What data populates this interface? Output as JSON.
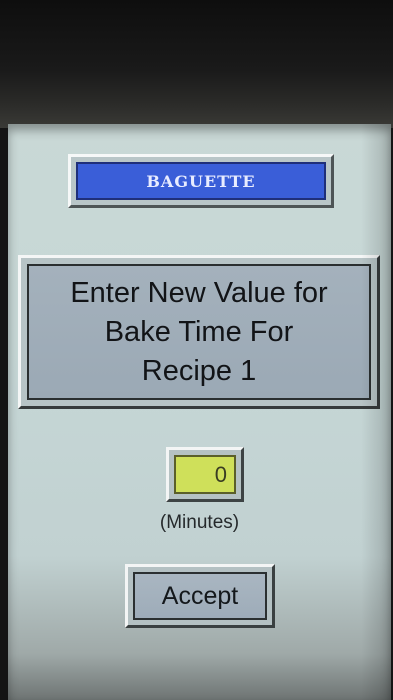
{
  "header": {
    "recipe_name": "BAGUETTE"
  },
  "prompt": {
    "line1": "Enter New Value for",
    "line2": "Bake Time For",
    "line3": "Recipe 1"
  },
  "value_field": {
    "value": "0",
    "unit_label": "(Minutes)"
  },
  "actions": {
    "accept_label": "Accept"
  },
  "colors": {
    "screen_bg": "#c6d7d6",
    "title_bg": "#3a5ed8",
    "value_bg": "#cfe05a",
    "button_bg": "#a9b6c1"
  }
}
